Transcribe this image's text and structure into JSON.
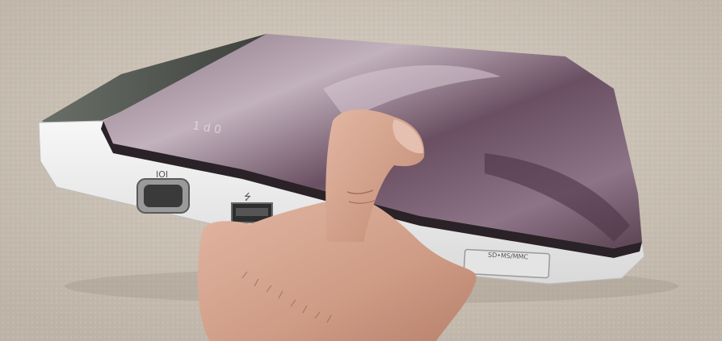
{
  "labels": {
    "vga_symbol": "IOI",
    "usb_symbol": "⭍",
    "card_slot": "SD•MS/MMC",
    "lid_brand": "1 d 0"
  },
  "colors": {
    "carpet": "#cfc6bb",
    "lid_purple": "#6e5566",
    "lid_highlight": "#b9a7b3",
    "base_white": "#eeeeee",
    "skin": "#d9a892"
  }
}
